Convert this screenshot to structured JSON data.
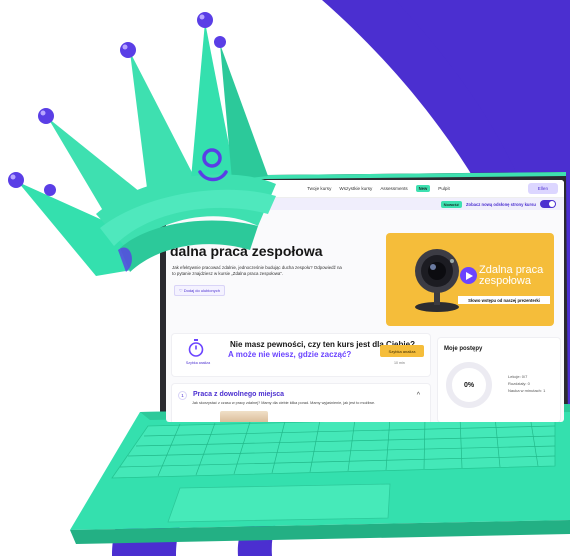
{
  "colors": {
    "purple": "#4b2fd0",
    "mint": "#3ee0b0",
    "yellow": "#f5bd3a"
  },
  "topnav": {
    "items": [
      "Twoje kursy",
      "Wszystkie kursy",
      "Assessments"
    ],
    "new_badge": "New",
    "last_item": "Pulpit",
    "user": "Ellen"
  },
  "new_bar": {
    "pill": "Nowość",
    "text": "Zobacz nową odsłonę strony kursu"
  },
  "course": {
    "title": "dalna praca zespołowa",
    "description": "Jak efektywnie pracować zdalnie, jednocześnie budując ducha zespołu? Odpowiedź na to pytanie znajdziesz w kursie „Zdalna praca zespołowa”.",
    "add_favorite": "Dodaj do ulubionych"
  },
  "video": {
    "title": "Zdalna praca zespołowa",
    "caption": "Słowo wstępu od naszej prezenterki"
  },
  "quiz": {
    "label": "Szybka analiza",
    "heading": "Nie masz pewności, czy ten kurs jest dla Ciebie?",
    "subheading": "A może nie wiesz, gdzie zacząć?",
    "button": "Szybka analiza",
    "time": "10 min"
  },
  "progress": {
    "title": "Moje postępy",
    "percent": "0%",
    "percent_value": 0,
    "stats": [
      "Lekcje: 0/7",
      "Rozdziały: 0",
      "Nauka w minutach: 1"
    ]
  },
  "lesson": {
    "number": "1",
    "title": "Praca z dowolnego miejsca",
    "subtitle": "Jak skorzystać z czasu w pracy zdalnej? Mamy dla ciebie kilka porad. Mamy wyjaśnienie, jak jest to możliwe.",
    "chevron": "^"
  },
  "crown": {
    "logo": "g"
  }
}
